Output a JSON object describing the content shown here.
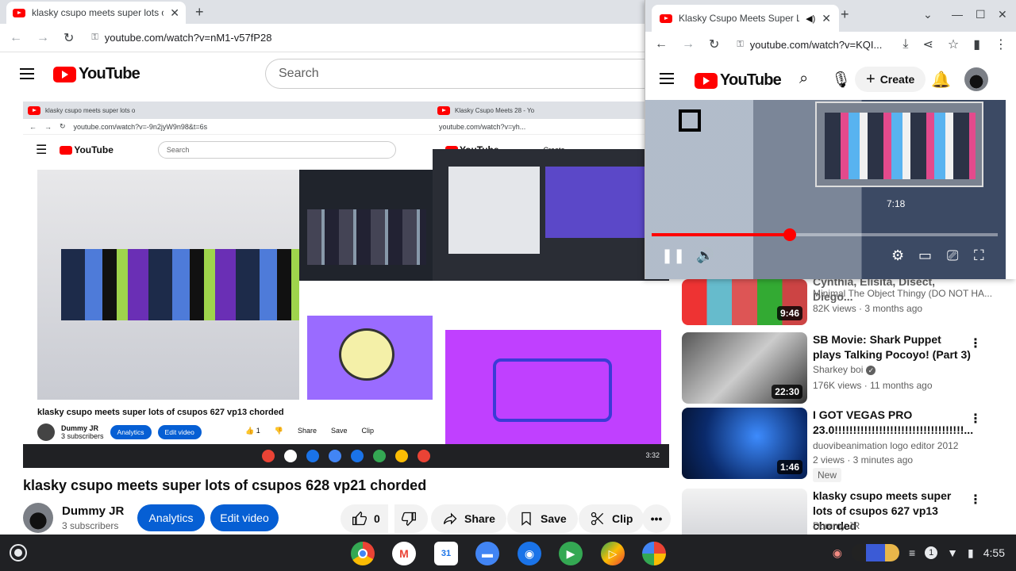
{
  "browser": {
    "tab_title": "klasky csupo meets super lots o",
    "url": "youtube.com/watch?v=nM1-v57fP28",
    "new_tab_label": "+"
  },
  "youtube": {
    "logo_text": "YouTube",
    "search_placeholder": "Search"
  },
  "embedded_video": {
    "inner_tab_title": "klasky csupo meets super lots o",
    "inner_url": "youtube.com/watch?v=-9n2jyW9n98&t=6s",
    "inner_logo": "YouTube",
    "inner_search": "Search",
    "inner_video_title": "klasky csupo meets super lots of csupos 627 vp13 chorded",
    "inner_channel": "Dummy JR",
    "inner_subs": "3 subscribers",
    "inner_analytics": "Analytics",
    "inner_edit": "Edit video",
    "inner_likes": "1",
    "inner_share": "Share",
    "inner_save": "Save",
    "inner_clip": "Clip",
    "right_tab_title": "Klasky Csupo Meets 28 - Yo",
    "right_url": "youtube.com/watch?v=yh...",
    "right_create": "Create",
    "clock": "3:32"
  },
  "video_info": {
    "title": "klasky csupo meets super lots of csupos 628 vp21 chorded",
    "channel": "Dummy JR",
    "subscribers": "3 subscribers",
    "analytics_label": "Analytics",
    "edit_label": "Edit video",
    "likes": "0",
    "share_label": "Share",
    "save_label": "Save",
    "clip_label": "Clip"
  },
  "pip_window": {
    "tab_title": "Klasky Csupo Meets Super L",
    "url": "youtube.com/watch?v=KQI...",
    "logo_text": "YouTube",
    "create_label": "Create",
    "time_tooltip": "7:18",
    "progress_fraction": 0.4
  },
  "related": [
    {
      "title": "Cynthia, Elisita, Disect, Diego...",
      "channel": "Minimal The Object Thingy (DO NOT HA...",
      "meta": "82K views · 3 months ago",
      "duration": "9:46"
    },
    {
      "title": "SB Movie: Shark Puppet plays Talking Pocoyo! (Part 3)",
      "channel": "Sharkey boi",
      "meta": "176K views · 11 months ago",
      "duration": "22:30"
    },
    {
      "title": "I GOT VEGAS PRO 23.0!!!!!!!!!!!!!!!!!!!!!!!!!!!!!!!!!!!...",
      "channel": "duovibeanimation logo editor 2012",
      "meta": "2 views · 3 minutes ago",
      "duration": "1:46",
      "badge": "New"
    },
    {
      "title": "klasky csupo meets super lots of csupos 627 vp13 chorded",
      "channel": "Dummy JR",
      "meta": "",
      "duration": ""
    }
  ],
  "shelf": {
    "clock": "4:55",
    "notification_count": "1",
    "apps": [
      "chrome-icon",
      "gmail-icon",
      "calendar-icon",
      "files-icon",
      "chat-icon",
      "meet-icon",
      "play-store-icon",
      "photos-icon"
    ]
  },
  "colors": {
    "youtube_red": "#ff0000",
    "primary_blue": "#065fd4",
    "shelf_bg": "#202124"
  }
}
